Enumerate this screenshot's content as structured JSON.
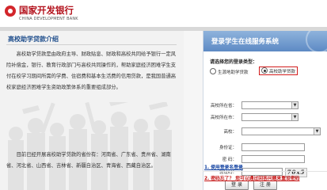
{
  "brand": {
    "name_cn": "国家开发银行",
    "name_en": "CHINA DEVELOPMENT BANK",
    "color": "#b3121c"
  },
  "intro": {
    "title": "高校助学贷款介绍",
    "paragraph1": "高校助学贷款是由政府主导、财政贴息、财政和高校共同给予银行一定风险补偿金，银行、教育行政部门与高校共同操作的，帮助家庭经济困难学生支付在校学习期间所需的学费、住宿费和基本生活费的信用贷款，是我国普通高校家庭经济困难学生资助政策体系的重要组成部分。",
    "paragraph2": "目前已经开展高校助学贷款的省份有：河南省、广东省、贵州省、湖南省、河北省、山西省、吉林省、新疆自治区、青海省、西藏自治区。"
  },
  "login": {
    "header": "登录学生在线服务系统",
    "prompt": "请选择您的登录类型：",
    "radio_options": [
      "生源地助学贷款",
      "高校助学贷款"
    ],
    "selected_option": "高校助学贷款",
    "fields": {
      "province_label": "高校所在省：",
      "city_label": "高校所在市：",
      "school_label": "高校：",
      "id_label": "身份证：",
      "password_label": "密  码：",
      "captcha_label": "验证码："
    },
    "captcha_text": "70x5",
    "login_button": "登 录",
    "reset_button": "注 册",
    "link_help": "1. 使用登录名登录",
    "link_forgot": "2. 密码忘了？ 您可以通过回答问题来重设密码"
  }
}
